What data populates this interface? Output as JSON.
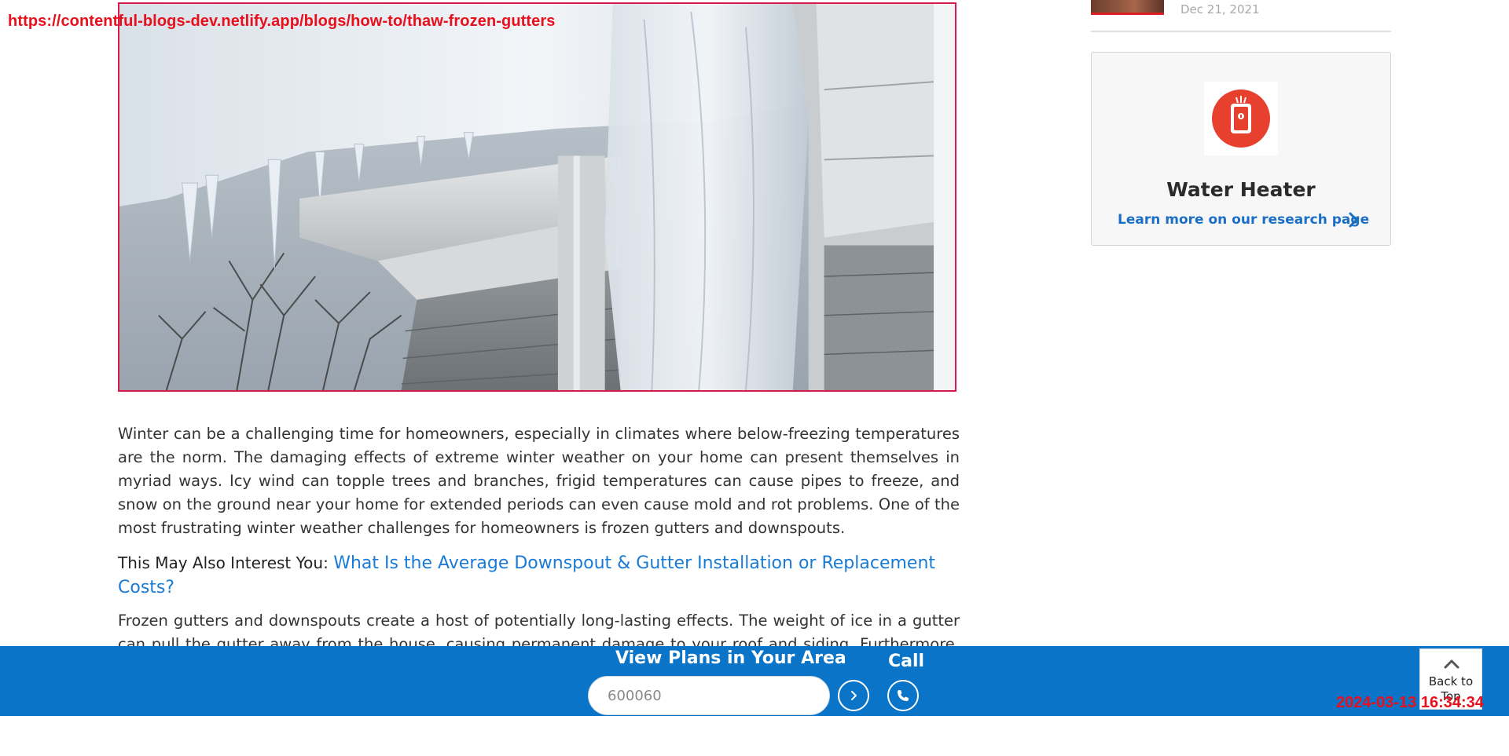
{
  "overlay": {
    "url": "https://contentful-blogs-dev.netlify.app/blogs/how-to/thaw-frozen-gutters",
    "timestamp": "2024-03-13 16:34:34"
  },
  "hero": {
    "icon": "photo-frozen-gutter"
  },
  "article": {
    "paragraph1": "Winter can be a challenging time for homeowners, especially in climates where below-freezing temperatures are the norm. The damaging effects of extreme winter weather on your home can present themselves in myriad ways. Icy wind can topple trees and branches, frigid temperatures can cause pipes to freeze, and snow on the ground near your home for extended periods can even cause mold and rot problems. One of the most frustrating winter weather challenges for homeowners is frozen gutters and downspouts.",
    "interest_label": "This May Also Interest You:",
    "interest_link": "What Is the Average Downspout & Gutter Installation or Replacement Costs?",
    "paragraph2": "Frozen gutters and downspouts create a host of potentially long-lasting effects. The weight of ice in a gutter can pull the gutter away from the house, causing permanent damage to your roof and siding. Furthermore, ice-clogged gutters — or ice dams — can lead to major moisture problems. Melting snow on the roof will have no place to travel and can"
  },
  "sidebar": {
    "recent_date": "Dec 21, 2021",
    "card_title": "Water Heater",
    "card_link": "Learn more on our research page",
    "card_icon": "water-heater-icon",
    "accent": "#e8402e"
  },
  "bottom_bar": {
    "title": "View Plans in Your Area",
    "zip_value": "600060",
    "call_label": "Call",
    "back_to_top": "Back to Top",
    "bg_color": "#0a74c8"
  }
}
